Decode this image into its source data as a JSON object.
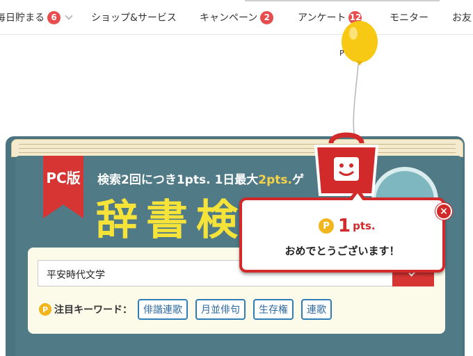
{
  "nav": {
    "items": [
      {
        "label": "毎日貯まる",
        "badge": "6",
        "dropdown": true
      },
      {
        "label": "ショップ&サービス"
      },
      {
        "label": "キャンペーン",
        "badge": "2"
      },
      {
        "label": "アンケート",
        "badge": "12"
      },
      {
        "label": "モニター"
      },
      {
        "label": "お友"
      }
    ]
  },
  "balloon": {
    "caption": "P"
  },
  "book": {
    "bookmark": "PC版",
    "tagline_prefix": "検索2回につき1pts. 1日最大",
    "tagline_highlight": "2pts.",
    "tagline_suffix": "ゲ",
    "title": "辞書検索",
    "search": {
      "value": "平安時代文学"
    },
    "keywords": {
      "label": "注目キーワード：",
      "items": [
        "俳諧連歌",
        "月並俳句",
        "生存権",
        "連歌"
      ]
    }
  },
  "popup": {
    "coin": "P",
    "points": "1",
    "unit": "pts.",
    "message": "おめでとうございます！",
    "close": "×"
  },
  "colors": {
    "accent_red": "#d22a2a",
    "book_teal": "#4f7a86",
    "title_yellow": "#f6e33a",
    "coin_gold": "#f2b51c",
    "chip_blue": "#2e7db5"
  },
  "icons": [
    "chevron-down-icon",
    "balloon-icon",
    "search-icon",
    "point-coin-icon",
    "shopping-bag-mascot-icon",
    "close-icon"
  ]
}
